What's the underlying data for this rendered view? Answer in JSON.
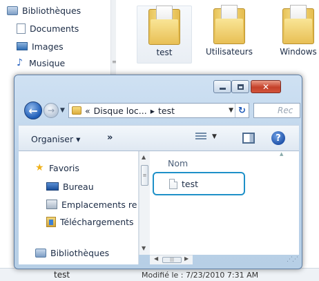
{
  "background": {
    "nav": {
      "libraries": "Bibliothèques",
      "documents": "Documents",
      "images": "Images",
      "music": "Musique"
    },
    "folders": [
      {
        "label": "test"
      },
      {
        "label": "Utilisateurs"
      },
      {
        "label": "Windows"
      }
    ],
    "status": {
      "name": "test",
      "modified": "Modifié le : 7/23/2010 7:31 AM"
    }
  },
  "dialog": {
    "address": {
      "overflow": "«",
      "parent": "Disque loc...",
      "separator": "▸",
      "current": "test"
    },
    "search_placeholder": "Rec",
    "toolbar": {
      "organize": "Organiser ▾",
      "more": "»"
    },
    "nav": {
      "favorites": "Favoris",
      "desktop": "Bureau",
      "places": "Emplacements re",
      "downloads": "Téléchargements",
      "libraries": "Bibliothèques"
    },
    "column_header": "Nom",
    "files": [
      {
        "name": "test"
      }
    ]
  }
}
